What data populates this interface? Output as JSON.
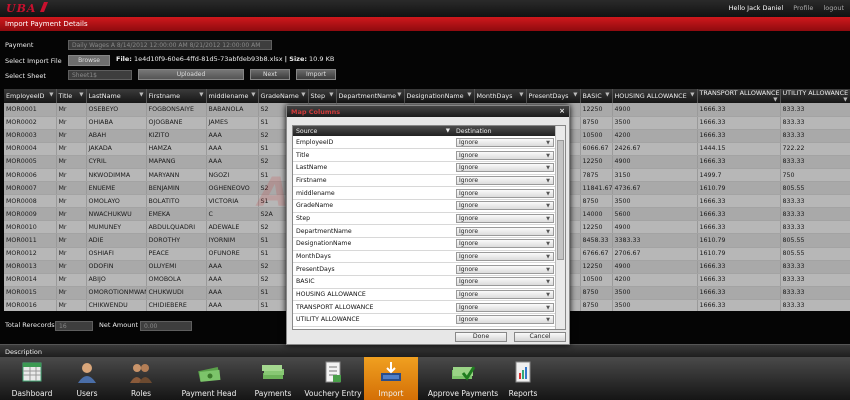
{
  "app": {
    "logo": "UBA",
    "user_greeting": "Hello Jack Daniel",
    "profile_link": "Profile",
    "logout_link": "logout"
  },
  "page_title": "Import Payment Details",
  "form": {
    "payment_label": "Payment",
    "payment_value": "Daily Wages A 8/14/2012 12:00:00 AM 8/21/2012 12:00:00 AM",
    "import_file_label": "Select Import File",
    "browse_label": "Browse",
    "file_prefix": "File:",
    "file_name": "1e4d10f9-60e6-4ffd-81d5-73abfdeb93b8.xlsx",
    "size_prefix": "| Size:",
    "file_size": "10.9 KB",
    "sheet_label": "Select Sheet",
    "sheet_value": "Sheet1$",
    "uploaded_label": "Uploaded",
    "next_label": "Next",
    "import_label": "Import"
  },
  "grid": {
    "columns": [
      "EmployeeID",
      "Title",
      "LastName",
      "Firstname",
      "middlename",
      "GradeName",
      "Step",
      "DepartmentName",
      "DesignationName",
      "MonthDays",
      "PresentDays",
      "BASIC",
      "HOUSING ALLOWANCE",
      "TRANSPORT ALLOWANCE",
      "UTILITY ALLOWANCE"
    ],
    "rows": [
      [
        "MOR0001",
        "Mr",
        "OSEBEYO",
        "FOGBONSAIYE",
        "BABANOLA",
        "S2",
        "",
        "",
        "",
        "",
        "",
        "12250",
        "4900",
        "1666.33",
        "833.33"
      ],
      [
        "MOR0002",
        "Mr",
        "OHIABA",
        "OJOGBANE",
        "JAMES",
        "S1",
        "",
        "",
        "",
        "",
        "",
        "8750",
        "3500",
        "1666.33",
        "833.33"
      ],
      [
        "MOR0003",
        "Mr",
        "ABAH",
        "KIZITO",
        "AAA",
        "S2",
        "",
        "",
        "",
        "",
        "",
        "10500",
        "4200",
        "1666.33",
        "833.33"
      ],
      [
        "MOR0004",
        "Mr",
        "JAKADA",
        "HAMZA",
        "AAA",
        "S1",
        "",
        "",
        "",
        "",
        "",
        "6066.67",
        "2426.67",
        "1444.15",
        "722.22"
      ],
      [
        "MOR0005",
        "Mr",
        "CYRIL",
        "MAPANG",
        "AAA",
        "S2",
        "",
        "",
        "",
        "",
        "",
        "12250",
        "4900",
        "1666.33",
        "833.33"
      ],
      [
        "MOR0006",
        "Mr",
        "NKWODIMMA",
        "MARYANN",
        "NGOZI",
        "S1",
        "",
        "",
        "",
        "",
        "",
        "7875",
        "3150",
        "1499.7",
        "750"
      ],
      [
        "MOR0007",
        "Mr",
        "ENUEME",
        "BENJAMIN",
        "OGHENEOVO",
        "S2",
        "",
        "",
        "",
        "",
        "",
        "11841.67",
        "4736.67",
        "1610.79",
        "805.55"
      ],
      [
        "MOR0008",
        "Mr",
        "OMOLAYO",
        "BOLATITO",
        "VICTORIA",
        "S1",
        "",
        "",
        "",
        "",
        "",
        "8750",
        "3500",
        "1666.33",
        "833.33"
      ],
      [
        "MOR0009",
        "Mr",
        "NWACHUKWU",
        "EMEKA",
        "C",
        "S2A",
        "",
        "",
        "",
        "",
        "",
        "14000",
        "5600",
        "1666.33",
        "833.33"
      ],
      [
        "MOR0010",
        "Mr",
        "MUMUNEY",
        "ABDULQUADRI",
        "ADEWALE",
        "S2",
        "",
        "",
        "",
        "",
        "",
        "12250",
        "4900",
        "1666.33",
        "833.33"
      ],
      [
        "MOR0011",
        "Mr",
        "ADIE",
        "DOROTHY",
        "IYORNIM",
        "S1",
        "",
        "",
        "",
        "",
        "",
        "8458.33",
        "3383.33",
        "1610.79",
        "805.55"
      ],
      [
        "MOR0012",
        "Mr",
        "OSHIAFI",
        "PEACE",
        "OFUNORE",
        "S1",
        "",
        "",
        "",
        "",
        "",
        "6766.67",
        "2706.67",
        "1610.79",
        "805.55"
      ],
      [
        "MOR0013",
        "Mr",
        "ODOFIN",
        "OLUYEMI",
        "AAA",
        "S2",
        "",
        "",
        "",
        "",
        "",
        "12250",
        "4900",
        "1666.33",
        "833.33"
      ],
      [
        "MOR0014",
        "Mr",
        "ABIJO",
        "OMOBOLA",
        "AAA",
        "S2",
        "",
        "",
        "",
        "",
        "",
        "10500",
        "4200",
        "1666.33",
        "833.33"
      ],
      [
        "MOR0015",
        "Mr",
        "OMOROTIONMWAN",
        "CHUKWUDI",
        "AAA",
        "S1",
        "",
        "",
        "",
        "",
        "",
        "8750",
        "3500",
        "1666.33",
        "833.33"
      ],
      [
        "MOR0016",
        "Mr",
        "CHIKWENDU",
        "CHIDIEBERE",
        "AAA",
        "S1",
        "",
        "",
        "",
        "",
        "",
        "8750",
        "3500",
        "1666.33",
        "833.33"
      ]
    ]
  },
  "watermark": "ADRIVE",
  "totals": {
    "records_label": "Total Rerecords",
    "records_value": "16",
    "net_label": "Net Amount",
    "net_value": "0.00"
  },
  "description_label": "Description",
  "nav": [
    {
      "label": "Dashboard",
      "icon": "spreadsheet-icon"
    },
    {
      "label": "Users",
      "icon": "user-icon"
    },
    {
      "label": "Roles",
      "icon": "group-icon"
    },
    {
      "label": "Payment Head",
      "icon": "cash-icon"
    },
    {
      "label": "Payments",
      "icon": "money-stack-icon"
    },
    {
      "label": "Vouchery Entry",
      "icon": "document-icon"
    },
    {
      "label": "Import",
      "icon": "import-icon",
      "active": true
    },
    {
      "label": "Approve Payments",
      "icon": "money-check-icon"
    },
    {
      "label": "Reports",
      "icon": "report-icon"
    }
  ],
  "modal": {
    "title": "Map Columns",
    "close": "×",
    "source_header": "Source",
    "destination_header": "Destination",
    "rows": [
      {
        "source": "EmployeeID",
        "destination": "Ignore"
      },
      {
        "source": "Title",
        "destination": "Ignore"
      },
      {
        "source": "LastName",
        "destination": "Ignore"
      },
      {
        "source": "Firstname",
        "destination": "Ignore"
      },
      {
        "source": "middlename",
        "destination": "Ignore"
      },
      {
        "source": "GradeName",
        "destination": "Ignore"
      },
      {
        "source": "Step",
        "destination": "Ignore"
      },
      {
        "source": "DepartmentName",
        "destination": "Ignore"
      },
      {
        "source": "DesignationName",
        "destination": "Ignore"
      },
      {
        "source": "MonthDays",
        "destination": "Ignore"
      },
      {
        "source": "PresentDays",
        "destination": "Ignore"
      },
      {
        "source": "BASIC",
        "destination": "Ignore"
      },
      {
        "source": "HOUSING ALLOWANCE",
        "destination": "Ignore"
      },
      {
        "source": "TRANSPORT ALLOWANCE",
        "destination": "Ignore"
      },
      {
        "source": "UTILITY ALLOWANCE",
        "destination": "Ignore"
      }
    ],
    "done_label": "Done",
    "cancel_label": "Cancel"
  },
  "colors": {
    "brand_red": "#c8102e",
    "title_red": "#d0181d",
    "active_orange": "#e8891a"
  }
}
